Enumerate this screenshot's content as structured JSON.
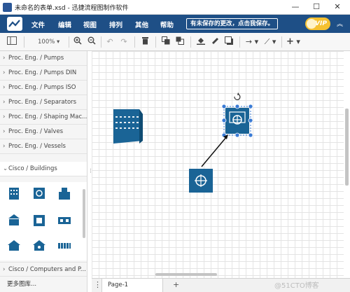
{
  "window": {
    "title": "未命名的表单.xsd - 迅捷流程图制作软件",
    "min_glyph": "—",
    "max_glyph": "☐",
    "close_glyph": "✕"
  },
  "menubar": {
    "items": [
      "文件",
      "编辑",
      "视图",
      "排列",
      "其他",
      "帮助"
    ],
    "save_notice": "有未保存的更改，点击我保存。",
    "vip_label": "VIP",
    "collapse_glyph": "︽"
  },
  "toolbar": {
    "zoom": "100%",
    "add_glyph": "+"
  },
  "sidebar": {
    "categories_top": [
      "Proc. Eng. / Pumps",
      "Proc. Eng. / Pumps DIN",
      "Proc. Eng. / Pumps ISO",
      "Proc. Eng. / Separators",
      "Proc. Eng. / Shaping Mac...",
      "Proc. Eng. / Valves",
      "Proc. Eng. / Vessels",
      "Cisco / Buildings"
    ],
    "category_bottom": "Cisco / Computers and P...",
    "more_libraries": "更多图库..."
  },
  "pages": {
    "active_tab": "Page-1",
    "add_glyph": "+",
    "menu_glyph": "⋮"
  },
  "watermark": "@51CTO博客",
  "colors": {
    "menubar": "#1e4f86",
    "shape_blue": "#1a6496",
    "selection": "#3a7bd5"
  }
}
